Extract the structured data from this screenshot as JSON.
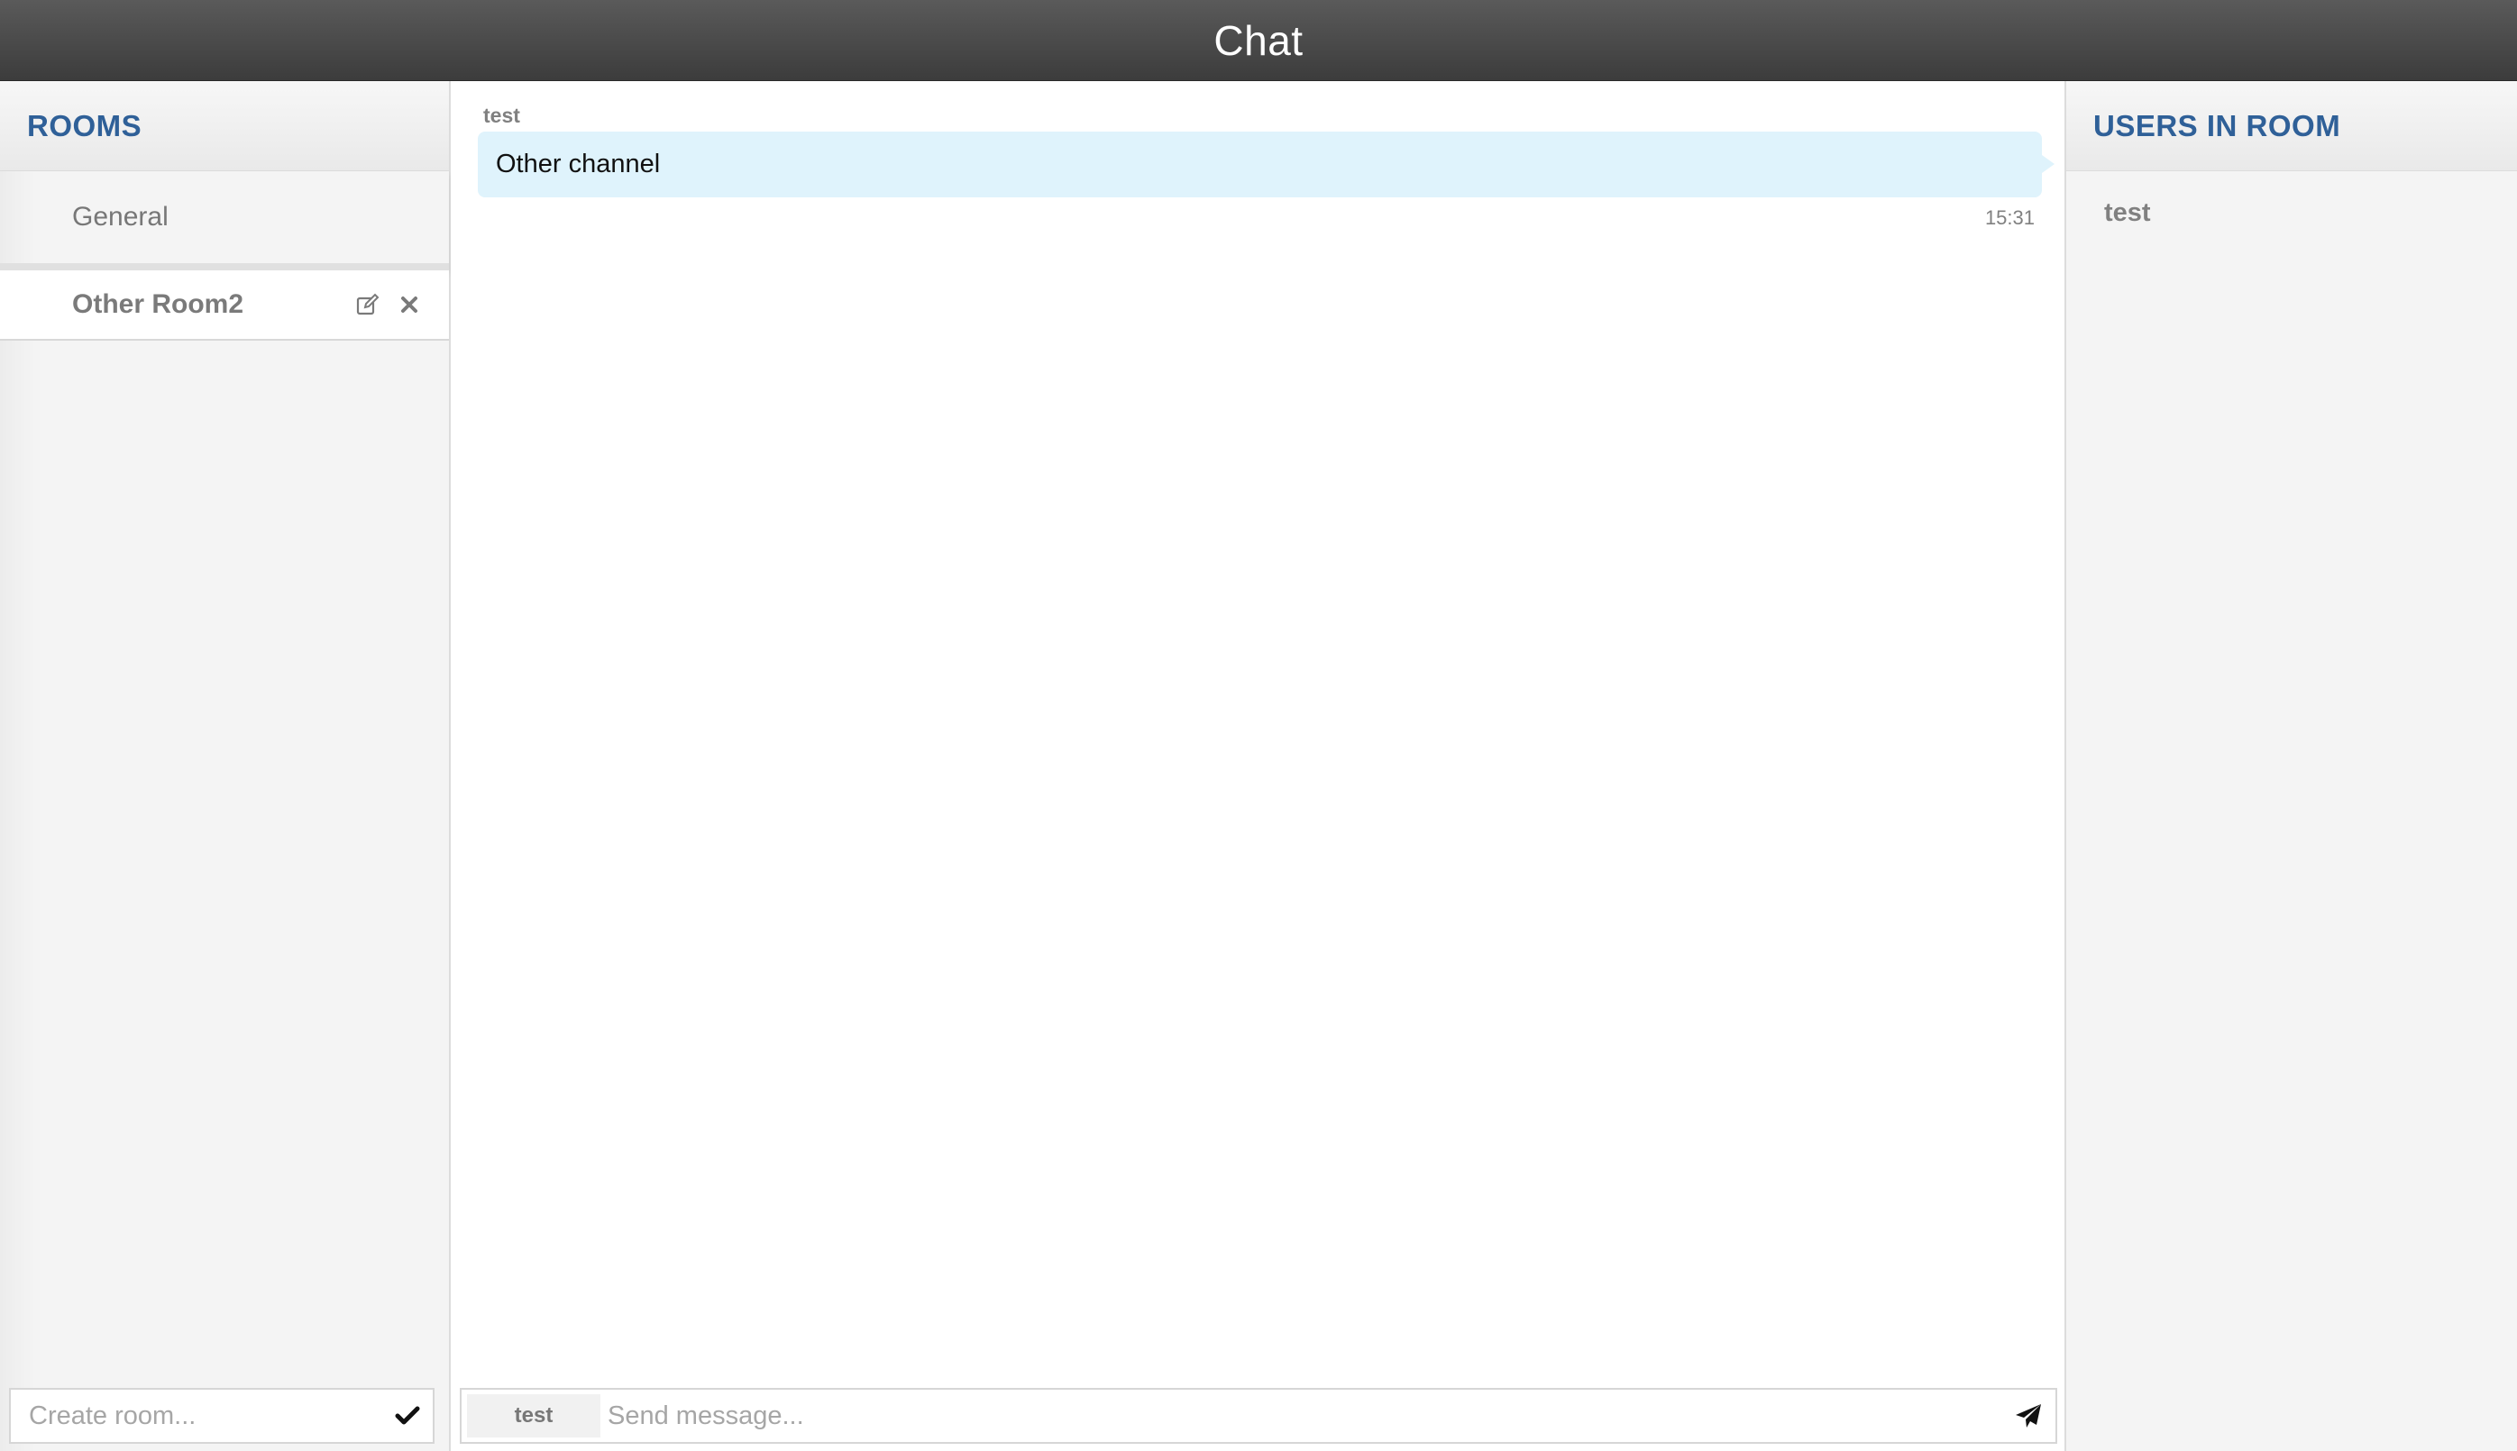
{
  "header": {
    "title": "Chat"
  },
  "rooms_panel": {
    "heading": "ROOMS",
    "rooms": [
      {
        "name": "General",
        "active": false
      },
      {
        "name": "Other Room2",
        "active": true
      }
    ],
    "active_room_actions": {
      "edit_icon": "edit-icon",
      "delete_icon": "close-icon"
    },
    "create_room": {
      "placeholder": "Create room...",
      "value": "",
      "confirm_icon": "checkmark-icon"
    }
  },
  "messages": [
    {
      "author": "test",
      "text": "Other channel",
      "time": "15:31"
    }
  ],
  "composer": {
    "sender": "test",
    "placeholder": "Send message...",
    "value": "",
    "send_icon": "send-icon"
  },
  "users_panel": {
    "heading": "USERS IN ROOM",
    "users": [
      "test"
    ]
  },
  "colors": {
    "header_bg": "#4a4a4a",
    "heading_text": "#2f6098",
    "bubble_bg": "#dff3fc",
    "panel_bg": "#f4f4f4"
  }
}
